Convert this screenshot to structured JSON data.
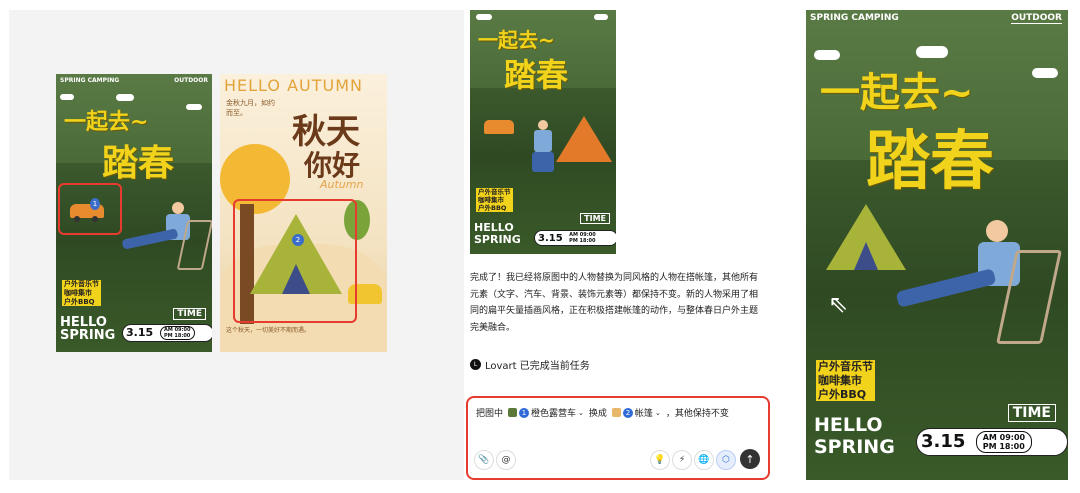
{
  "poster_spring_small": {
    "header_left": "SPRING CAMPING",
    "header_right": "OUTDOOR",
    "title_line1": "一起去~",
    "title_line2": "踏春",
    "tags": [
      "户外音乐节",
      "咖啡集市",
      "户外BBQ"
    ],
    "time_label": "TIME",
    "hello": "HELLO",
    "spring": "SPRING",
    "date": "3.15",
    "time_am": "AM 09:00",
    "time_pm": "PM 18:00",
    "marker_1": "1"
  },
  "poster_autumn": {
    "title_en": "HELLO AUTUMN",
    "subtitle_cn": "金秋九月，如约而至。",
    "title_line1": "秋天",
    "title_line2": "你好",
    "script": "Autumn",
    "footer_cn": "这个秋天，一切美好不期而遇。",
    "marker_2": "2"
  },
  "preview_thumb": {
    "title_line1": "一起去~",
    "title_line2": "踏春",
    "tags": [
      "户外音乐节",
      "咖啡集市",
      "户外BBQ"
    ],
    "time_label": "TIME",
    "hello": "HELLO",
    "spring": "SPRING",
    "date": "3.15",
    "time_am": "AM 09:00",
    "time_pm": "PM 18:00"
  },
  "chat": {
    "assistant_message": "完成了！我已经将原图中的人物替换为同风格的人物在搭帐篷，其他所有元素（文字、汽车、背景、装饰元素等）都保持不变。新的人物采用了相同的扁平矢量插画风格，正在积极搭建帐篷的动作，与整体春日户外主题完美融合。",
    "status_text": "Lovart 已完成当前任务",
    "status_logo": "L"
  },
  "input": {
    "prefix": "把图中",
    "chip1_num": "1",
    "chip1_label": "橙色露营车",
    "middle": "换成",
    "chip2_num": "2",
    "chip2_label": "帐篷",
    "suffix": "，其他保持不变"
  },
  "toolbar": {
    "attach_icon": "📎",
    "mention_icon": "@",
    "bulb_icon": "💡",
    "bolt_icon": "⚡",
    "globe_icon": "🌐",
    "cube_icon": "⬡",
    "send_icon": "↑"
  },
  "poster_spring_large": {
    "header_left": "SPRING CAMPING",
    "header_right": "OUTDOOR",
    "title_line1": "一起去~",
    "title_line2": "踏春",
    "tags": [
      "户外音乐节",
      "咖啡集市",
      "户外BBQ"
    ],
    "time_label": "TIME",
    "hello": "HELLO",
    "spring": "SPRING",
    "date": "3.15",
    "time_am": "AM 09:00",
    "time_pm": "PM 18:00"
  }
}
